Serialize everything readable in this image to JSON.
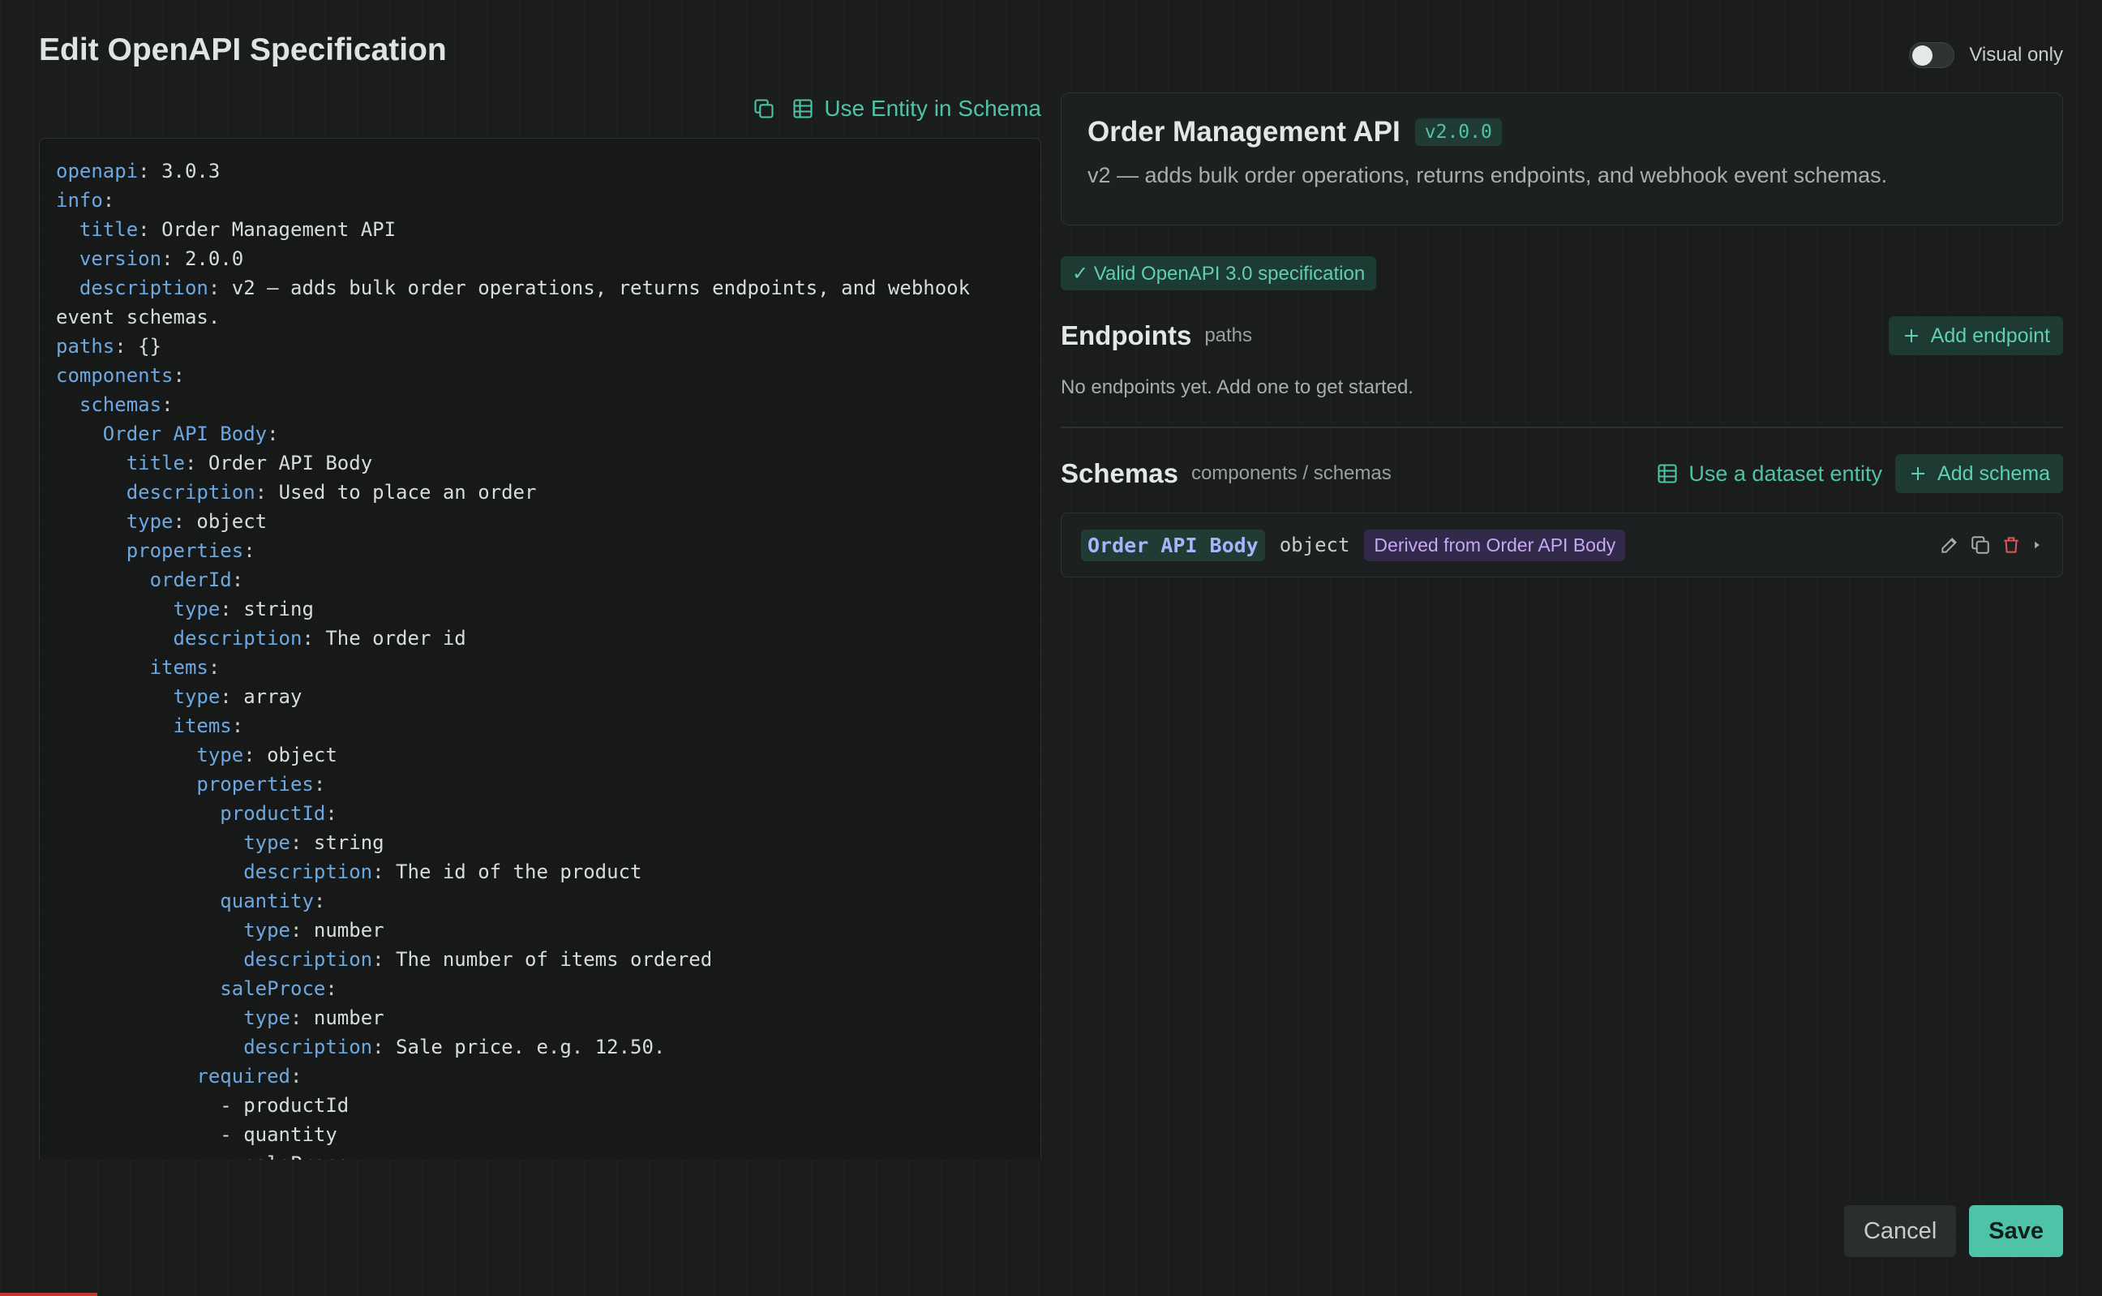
{
  "dialog": {
    "title": "Edit OpenAPI Specification",
    "visual_only_label": "Visual only",
    "visual_only_on": false
  },
  "editor": {
    "use_entity_label": "Use Entity in Schema",
    "lines": [
      {
        "indent": 0,
        "key": "openapi",
        "value": "3.0.3"
      },
      {
        "indent": 0,
        "key": "info",
        "value": ""
      },
      {
        "indent": 1,
        "key": "title",
        "value": "Order Management API"
      },
      {
        "indent": 1,
        "key": "version",
        "value": "2.0.0"
      },
      {
        "indent": 1,
        "key": "description",
        "value": "v2 — adds bulk order operations, returns endpoints, and webhook"
      },
      {
        "indent": 0,
        "key": "",
        "value": "event schemas."
      },
      {
        "indent": 0,
        "key": "paths",
        "value": "{}"
      },
      {
        "indent": 0,
        "key": "components",
        "value": ""
      },
      {
        "indent": 1,
        "key": "schemas",
        "value": ""
      },
      {
        "indent": 2,
        "key": "Order API Body",
        "value": ""
      },
      {
        "indent": 3,
        "key": "title",
        "value": "Order API Body"
      },
      {
        "indent": 3,
        "key": "description",
        "value": "Used to place an order"
      },
      {
        "indent": 3,
        "key": "type",
        "value": "object"
      },
      {
        "indent": 3,
        "key": "properties",
        "value": ""
      },
      {
        "indent": 4,
        "key": "orderId",
        "value": ""
      },
      {
        "indent": 5,
        "key": "type",
        "value": "string"
      },
      {
        "indent": 5,
        "key": "description",
        "value": "The order id"
      },
      {
        "indent": 4,
        "key": "items",
        "value": ""
      },
      {
        "indent": 5,
        "key": "type",
        "value": "array"
      },
      {
        "indent": 5,
        "key": "items",
        "value": ""
      },
      {
        "indent": 6,
        "key": "type",
        "value": "object"
      },
      {
        "indent": 6,
        "key": "properties",
        "value": ""
      },
      {
        "indent": 7,
        "key": "productId",
        "value": ""
      },
      {
        "indent": 8,
        "key": "type",
        "value": "string"
      },
      {
        "indent": 8,
        "key": "description",
        "value": "The id of the product"
      },
      {
        "indent": 7,
        "key": "quantity",
        "value": ""
      },
      {
        "indent": 8,
        "key": "type",
        "value": "number"
      },
      {
        "indent": 8,
        "key": "description",
        "value": "The number of items ordered"
      },
      {
        "indent": 7,
        "key": "saleProce",
        "value": ""
      },
      {
        "indent": 8,
        "key": "type",
        "value": "number"
      },
      {
        "indent": 8,
        "key": "description",
        "value": "Sale price. e.g. 12.50."
      },
      {
        "indent": 6,
        "key": "required",
        "value": ""
      },
      {
        "indent": 7,
        "key": "",
        "value": "- productId"
      },
      {
        "indent": 7,
        "key": "",
        "value": "- quantity"
      },
      {
        "indent": 7,
        "key": "",
        "value": "- saleProce"
      }
    ]
  },
  "info": {
    "title": "Order Management API",
    "version_badge": "v2.0.0",
    "description": "v2 — adds bulk order operations, returns endpoints, and webhook event schemas."
  },
  "validation": {
    "label": "✓ Valid OpenAPI 3.0 specification"
  },
  "endpoints": {
    "title": "Endpoints",
    "subtitle": "paths",
    "add_label": "Add endpoint",
    "empty_message": "No endpoints yet. Add one to get started."
  },
  "schemas": {
    "title": "Schemas",
    "subtitle": "components / schemas",
    "use_dataset_label": "Use a dataset entity",
    "add_label": "Add schema",
    "items": [
      {
        "name": "Order API Body",
        "type": "object",
        "derived": "Derived from Order API Body"
      }
    ]
  },
  "footer": {
    "cancel_label": "Cancel",
    "save_label": "Save"
  },
  "colors": {
    "accent": "#4fc3a7",
    "key": "#6ea8e0",
    "derived": "#c6a8f5"
  }
}
